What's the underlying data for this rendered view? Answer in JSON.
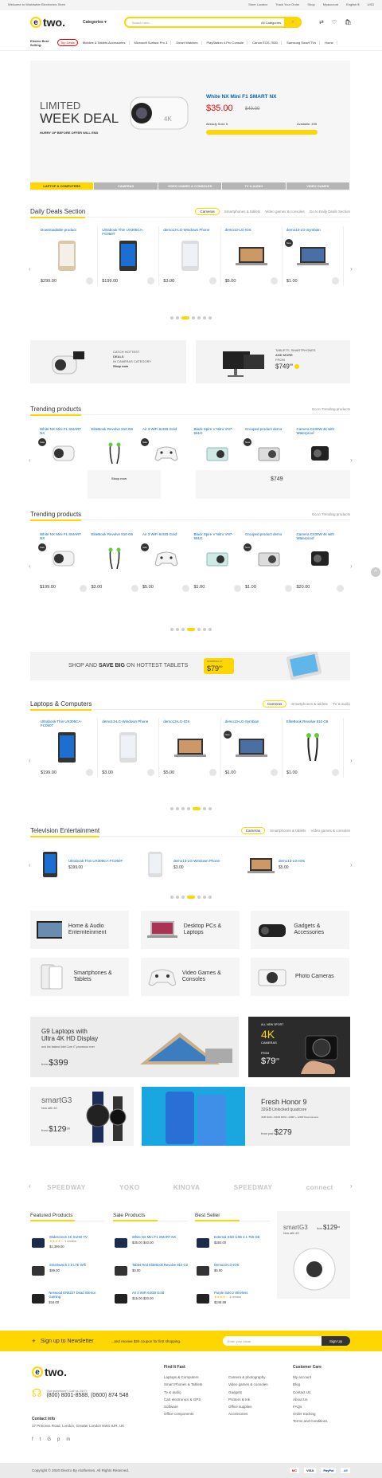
{
  "topbar": {
    "welcome": "Welcome to Worldwide Electronics Store",
    "links": [
      "Store Locator",
      "Track Your Order",
      "Shop",
      "Myaccount",
      "English $",
      "USD"
    ]
  },
  "header": {
    "logo": "two.",
    "logo_e": "e",
    "categories": "Categories",
    "search_placeholder": "Search here...",
    "all_categories": "All Categories"
  },
  "bestselling": {
    "title": "Electro Best Selling:",
    "items": [
      "Top Deals",
      "Mobiles & Tablets Accessories",
      "Microsoft Surface Pro 3",
      "Smart Watches",
      "PlayStation 4 Pro Console",
      "Canon EOS 700D",
      "Samsung Smart TVs",
      "Home"
    ]
  },
  "hero": {
    "l1": "LIMITED",
    "l2": "WEEK DEAL",
    "l3": "HURRY UP BEFORE OFFER WILL END",
    "product": "White NX Mini F1 SMART NX",
    "price": "$35.00",
    "old": "$40.00",
    "sold": "Already Sold: 5",
    "avail": "Available: 495",
    "tabs": [
      "LAPTOP & COMPUTERS",
      "CAMERAS",
      "VIDEO GAMES & CONSOLES",
      "TV & AUDIO",
      "VIDEO GAMES"
    ]
  },
  "daily": {
    "title": "Daily Deals Section",
    "tabs": [
      "Cameras",
      "Smartphones & tablets",
      "Video games & consoles",
      "Go to Daily Deals Section"
    ],
    "products": [
      {
        "name": "Downloadable product",
        "price": "$299.00"
      },
      {
        "name": "Ultrabook Thin UX305CA-FC050T",
        "price": "$199.00"
      },
      {
        "name": "demo13-LG-Windown Phone",
        "price": "$3.00"
      },
      {
        "name": "demo13-LG-IOS",
        "price": "$5.00"
      },
      {
        "name": "demo13-LG-Symbian",
        "price": "$1.00",
        "badge": "New"
      }
    ]
  },
  "promo1": {
    "a": "CATCH HOTTEST",
    "b": "DEALS",
    "c": "IN CAMERAS CATEGORY",
    "shop": "Shop now"
  },
  "promo2": {
    "a": "TABLETS, SMARTPHONES",
    "b": "AND MORE",
    "from": "FROM",
    "price": "$749",
    "cents": "99"
  },
  "trending1": {
    "title": "Trending products",
    "link": "Go to Trending products",
    "products": [
      {
        "name": "White NX Mini F1 SMART NX",
        "badge": "Sale"
      },
      {
        "name": "EliteBook Revolve 810 G6"
      },
      {
        "name": "Air 3 WiFi 64GB Gold",
        "badge": "Sale"
      },
      {
        "name": "Black Spire V Nitro VN7-591G"
      },
      {
        "name": "Grouped product demo",
        "badge": "New"
      },
      {
        "name": "Camera C430W 4k with Waterproof"
      }
    ]
  },
  "trending2": {
    "title": "Trending products",
    "link": "Go to Trending products",
    "products": [
      {
        "name": "White NX Mini F1 SMART NX",
        "badge": "Sale",
        "price": "$199.00"
      },
      {
        "name": "EliteBook Revolve 810 G6",
        "price": "$3.00"
      },
      {
        "name": "Air 3 WiFi 64GB Gold",
        "badge": "Sale",
        "price": "$5.00"
      },
      {
        "name": "Black Spire V Nitro VN7-591G",
        "price": "$1.00"
      },
      {
        "name": "Grouped product demo",
        "badge": "New",
        "price": "$1.00"
      },
      {
        "name": "Camera C430W 4k with Waterproof",
        "price": "$20.00"
      }
    ]
  },
  "tabletbanner": {
    "text1": "SHOP AND",
    "text2": "SAVE BIG",
    "text3": "ON HOTTEST TABLETS",
    "from": "STARTING AT",
    "price": "$79",
    "cents": "99"
  },
  "laptops": {
    "title": "Laptops & Computers",
    "tabs": [
      "Cameras",
      "Smartphones & tablets",
      "TV & audio"
    ],
    "products": [
      {
        "name": "Ultrabook Thin UX305CA-FC050T",
        "price": "$199.00"
      },
      {
        "name": "demo13-LG-Windown Phone",
        "price": "$3.00"
      },
      {
        "name": "demo13-LG-IOS",
        "price": "$5.00"
      },
      {
        "name": "demo13-LG-Symbian",
        "price": "$1.00",
        "badge": "New"
      },
      {
        "name": "EliteBook Revolve 810 G6",
        "price": "$1.00"
      }
    ]
  },
  "tv": {
    "title": "Television Entertainment",
    "tabs": [
      "Cameras",
      "Smartphones & tablets",
      "Video games & consoles"
    ],
    "products": [
      {
        "name": "Ultrabook Thin UX305CA-FC050T",
        "price": "$199.00"
      },
      {
        "name": "demo13-LG-Windown Phone",
        "price": "$3.00"
      },
      {
        "name": "demo13-LG-IOS",
        "price": "$5.00"
      }
    ]
  },
  "cats": [
    "Home & Audio Enternteinment",
    "Desktop PCs & Laptops",
    "Gadgets & Accessories",
    "Smartphones & Tablets",
    "Video Games & Consoles",
    "Photo Cameras"
  ],
  "ads": {
    "g9a": "G9 Laptops with",
    "g9b": "Ultra 4K HD Display",
    "g9c": "and the fastest Intel Core i7 processor ever",
    "g9from": "from",
    "g9price": "$399",
    "cam1": "ALL NEW SPORT",
    "cam2": "4K",
    "cam3": "CAMERAS",
    "camfrom": "FROM",
    "camprice": "$79",
    "camcents": "99",
    "sg": "smartG3",
    "sg2": "Now with 4G",
    "sgfrom": "from",
    "sgprice": "$129",
    "sgcents": "99",
    "honor": "Fresh Honor 9",
    "honor2": "32GB Unlocked quadcore",
    "honorspecs": "4GB RAM • 64GB ROM • 20MP + 12MP Dual Camera",
    "honorfrom": "from just",
    "honorprice": "$279"
  },
  "brands": [
    "SPEEDWAY",
    "YOKO",
    "KINOVA",
    "SPEEDWAY",
    "connect"
  ],
  "featured": {
    "title": "Featured Products",
    "items": [
      {
        "name": "Widescreen 4K SUHD TV",
        "price": "$2,399.00",
        "rev": "1 review"
      },
      {
        "name": "Smartwatch 2.0 LTE Wifi",
        "price": "$99.00"
      },
      {
        "name": "Nerwood EN5227 Dead Silence Gaming",
        "price": "$16.00"
      }
    ]
  },
  "sale": {
    "title": "Sale Products",
    "items": [
      {
        "name": "White NX Mini F1 SMART NX",
        "price": "$35.00 $40.00"
      },
      {
        "name": "Tablet Red EliteBook Revolve 810 G2",
        "price": "$0.00"
      },
      {
        "name": "Air 3 WiFi 64GB Gold",
        "price": "$15.00 $20.00"
      }
    ]
  },
  "top": {
    "title": "Best Seller",
    "items": [
      {
        "name": "External SSD USB 3.1 750 GB",
        "price": "$250.00"
      },
      {
        "name": "Demo13-LG-IOS",
        "price": "$5.00"
      },
      {
        "name": "Purple Solo 2 Wireless",
        "price": "$248.99",
        "rev": "1 review"
      }
    ]
  },
  "sideAd": {
    "a": "smartG3",
    "b": "Now with 4G",
    "from": "from",
    "price": "$129",
    "cents": "99"
  },
  "newsletter": {
    "title": "Sign up to Newsletter",
    "coupon": "...and receive $20 coupon for first shopping.",
    "placeholder": "Enter your email",
    "button": "Sign Up"
  },
  "footer": {
    "help": "Got questions? Call us 24/7!",
    "phone": "(800) 8001-8588, (0600) 874 548",
    "contact": "Contact info",
    "addr": "17 Princess Road, London, Greater London NW1 8JR, UK",
    "col1": {
      "h": "Find It Fast",
      "items": [
        "Laptops & Computers",
        "Smart Phones & Tablets",
        "Tv & audio",
        "Cart electronics & GPS",
        "Software",
        "Office components"
      ]
    },
    "col2": {
      "h": "",
      "items": [
        "Camera & photography",
        "Video games & consoles",
        "Gadgets",
        "Printers & Ink",
        "Office supplies",
        "Accessories"
      ]
    },
    "col3": {
      "h": "Customer Care",
      "items": [
        "My account",
        "Blog",
        "Contact Us",
        "About Us",
        "FAQs",
        "Order tracking",
        "Terms and Conditions"
      ]
    },
    "copyright": "Copyright © 2020 Electro By Alothemes. All Rights Reserved.",
    "pay": [
      "MC",
      "VISA",
      "PayPal",
      "AE"
    ]
  }
}
